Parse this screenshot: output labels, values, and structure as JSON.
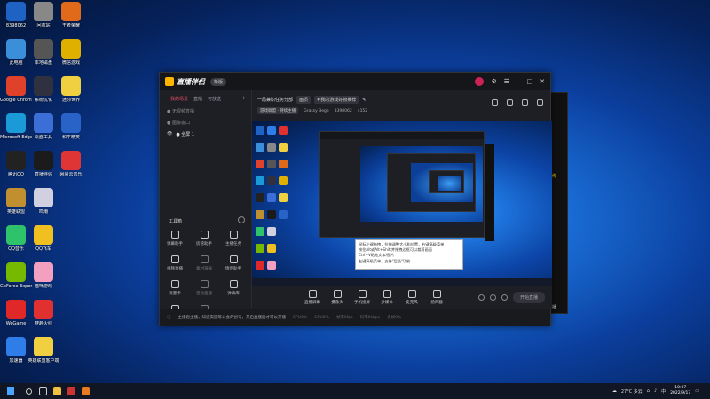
{
  "desktop": {
    "icons": [
      {
        "label": "8398062",
        "color": "#1e63c4"
      },
      {
        "label": "此电脑",
        "color": "#3a8fd8"
      },
      {
        "label": "Google Chrome",
        "color": "#e0412b"
      },
      {
        "label": "Microsoft Edge",
        "color": "#1a9ad6"
      },
      {
        "label": "腾讯QQ",
        "color": "#222222"
      },
      {
        "label": "英雄联盟",
        "color": "#c09030"
      },
      {
        "label": "QQ音乐",
        "color": "#2ec26a"
      },
      {
        "label": "GeForce Experience",
        "color": "#76b900"
      },
      {
        "label": "WeGame",
        "color": "#e02828"
      },
      {
        "label": "加速器",
        "color": "#2f7de8"
      },
      {
        "label": "回收站",
        "color": "#888888"
      },
      {
        "label": "本地磁盘",
        "color": "#555555"
      },
      {
        "label": "系统优化",
        "color": "#2f3140"
      },
      {
        "label": "桌面工具",
        "color": "#3b6ed6"
      },
      {
        "label": "直播伴侣",
        "color": "#1b1b1b"
      },
      {
        "label": "鸣潮",
        "color": "#d0d0e0"
      },
      {
        "label": "QQ飞车",
        "color": "#f0c020"
      },
      {
        "label": "猫咪游戏",
        "color": "#f3a0c0"
      },
      {
        "label": "穿越火线",
        "color": "#e03030"
      },
      {
        "label": "英雄联盟客户端",
        "color": "#f0d040"
      },
      {
        "label": "王者荣耀",
        "color": "#e06a1a"
      },
      {
        "label": "微信游戏",
        "color": "#e0b000"
      },
      {
        "label": "迷你世界",
        "color": "#f0d040"
      },
      {
        "label": "和平精英",
        "color": "#2a63c8"
      },
      {
        "label": "网易云音乐",
        "color": "#e03535"
      }
    ]
  },
  "app": {
    "title": "直播伴侣",
    "version": "新版",
    "left_tabs": [
      "我的场景",
      "直播",
      "可放送"
    ],
    "scenes": [
      "● 无视频直播",
      "● 图像窗口",
      "● 全屏 1"
    ],
    "tools_title": "工具箱",
    "tools": [
      {
        "label": "弹幕助手"
      },
      {
        "label": "房管助手"
      },
      {
        "label": "主播任务"
      },
      {
        "label": "视频直播"
      },
      {
        "label": "素材海报"
      },
      {
        "label": "情侣助手"
      },
      {
        "label": "流量卡"
      },
      {
        "label": "音效直播"
      },
      {
        "label": "弹幕库"
      },
      {
        "label": "多屏互动"
      },
      {
        "label": "PK连麦"
      }
    ],
    "info": {
      "room_title": "一局兼职任务分部",
      "tag1": "画质",
      "room_name": "#我的游戏好物推荐",
      "category": "游戏联盟 · 持续主播",
      "user": "Grassy Bege",
      "uid": "8398062",
      "popularity": "4152"
    },
    "tooltip": {
      "lines": [
        "鼠标左键拖拽，拉伸调整大小和位置，右键高级菜单",
        "按住Alt或Alt+Shift并拖拽边框可以裁剪画面",
        "Ctrl+V粘贴文本/图片",
        "右键高级菜单，支持\"层级\"功能"
      ]
    },
    "bottom": [
      {
        "label": "直播屏幕"
      },
      {
        "label": "摄像头"
      },
      {
        "label": "手机投屏"
      },
      {
        "label": "多媒体"
      },
      {
        "label": "麦克风"
      },
      {
        "label": "扬声器"
      }
    ],
    "start_btn": "开始直播",
    "status": {
      "notice": "主播您主播，知道实施等公会的创号，开启直播后才可以开播",
      "cpu": "CPU0%",
      "gpu": "GPU0%",
      "fps": "帧率0fps",
      "bitrate": "码率0kbps",
      "drop": "丢帧0%"
    }
  },
  "shadow_window": {
    "tag": "宣传",
    "tag2": "直播"
  },
  "taskbar": {
    "weather": "27°C 多云",
    "time": "10:07",
    "date": "2022/9/17",
    "ime": "中"
  }
}
